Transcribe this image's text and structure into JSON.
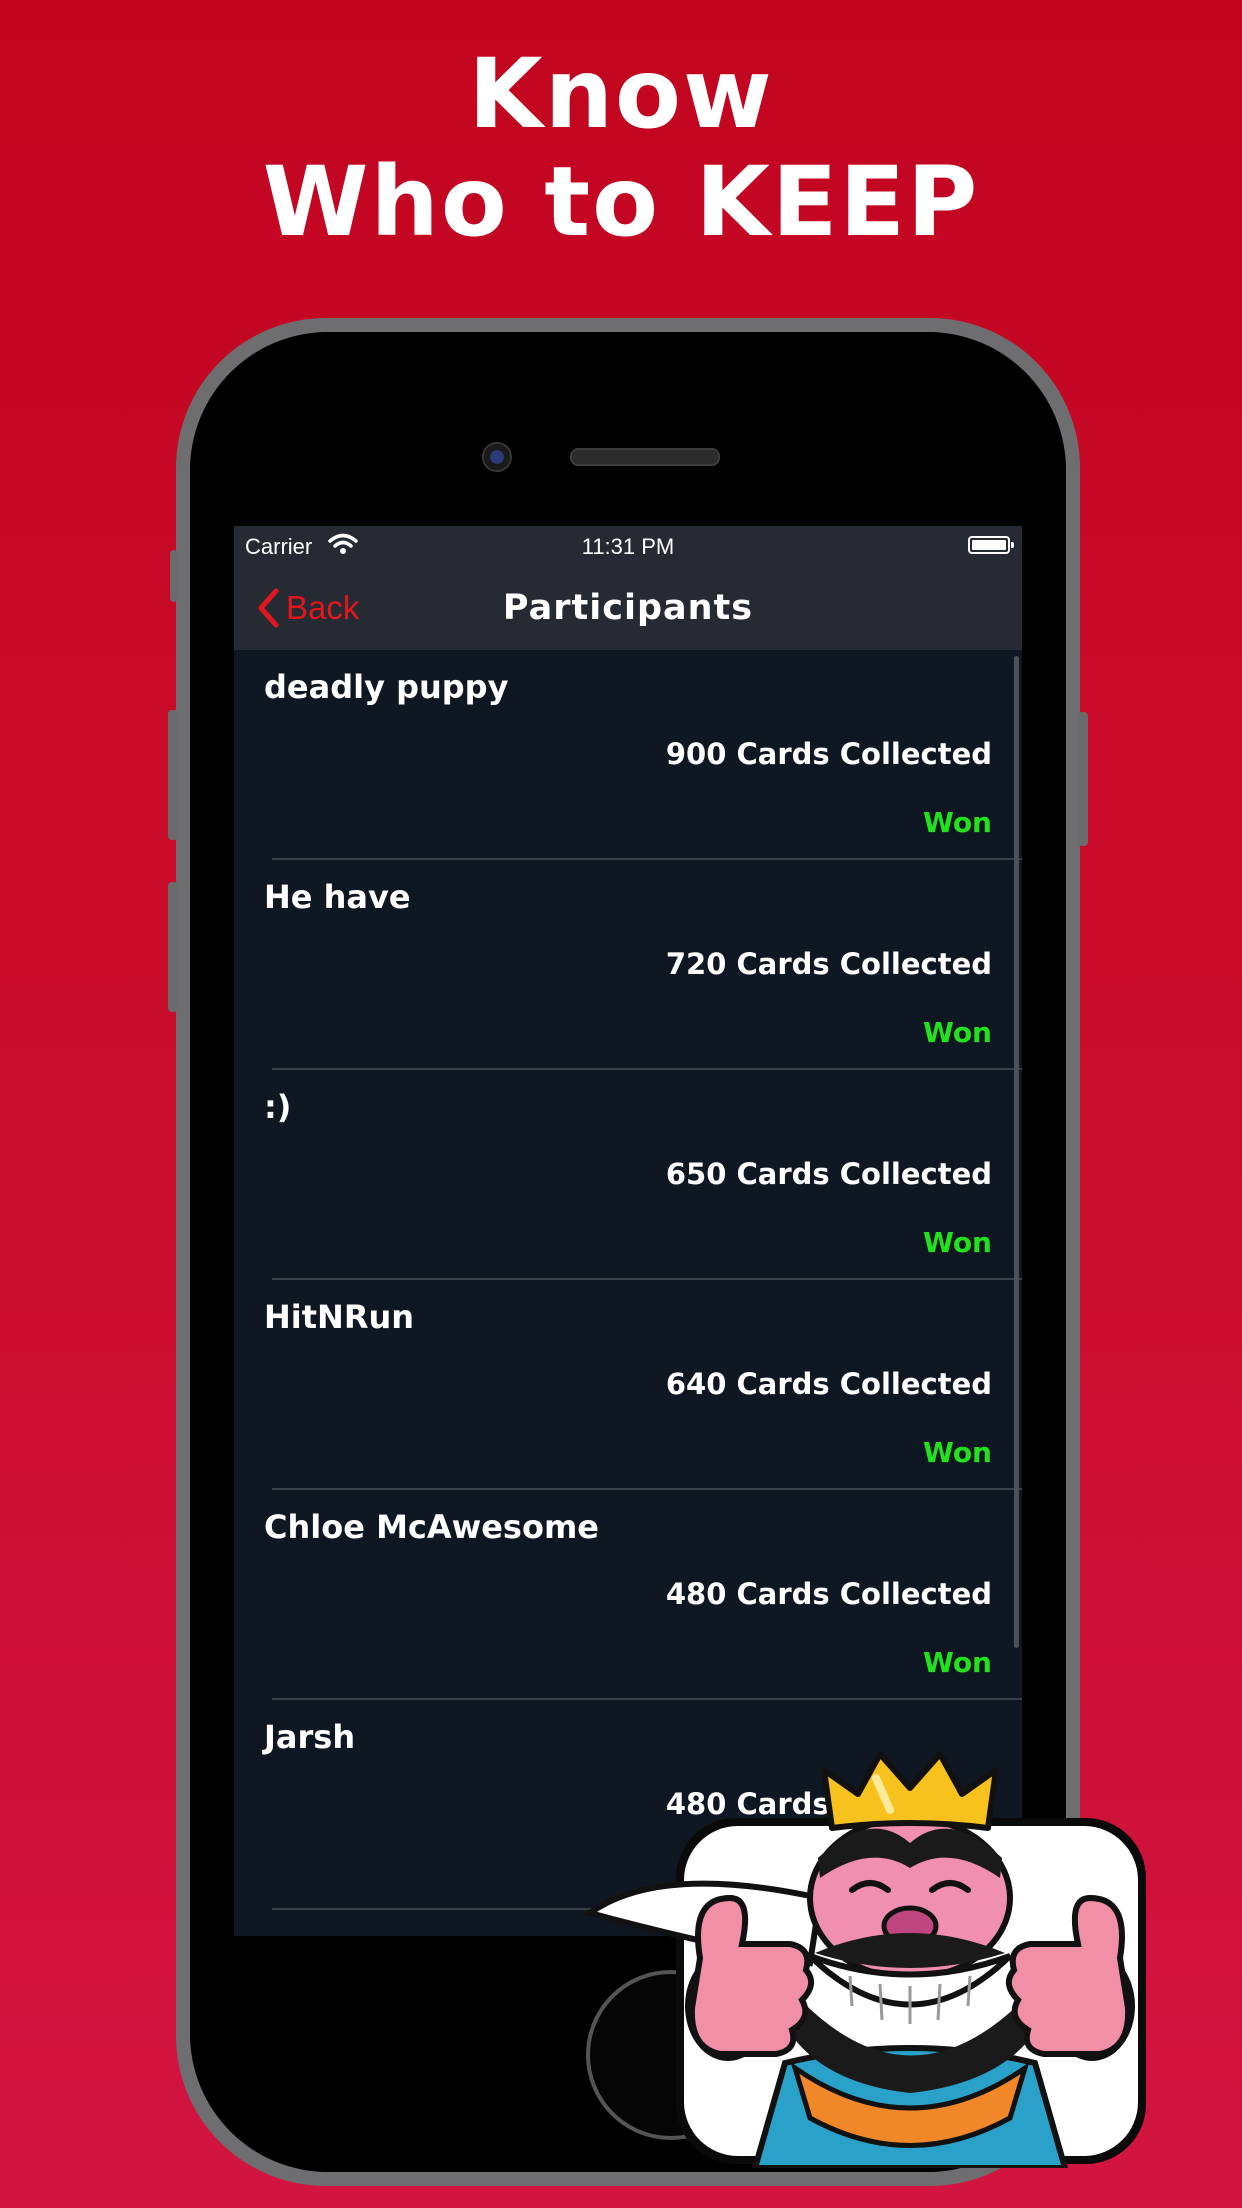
{
  "headline": {
    "line1": "Know",
    "line2": "Who to KEEP"
  },
  "status_bar": {
    "carrier": "Carrier",
    "time": "11:31 PM"
  },
  "nav": {
    "back_label": "Back",
    "title": "Participants"
  },
  "participants": [
    {
      "name": "deadly puppy",
      "cards": "900 Cards Collected",
      "result": "Won"
    },
    {
      "name": "He have",
      "cards": "720 Cards Collected",
      "result": "Won"
    },
    {
      "name": ":)",
      "cards": "650 Cards Collected",
      "result": "Won"
    },
    {
      "name": "HitNRun",
      "cards": "640 Cards Collected",
      "result": "Won"
    },
    {
      "name": "Chloe McAwesome",
      "cards": "480 Cards Collected",
      "result": "Won"
    },
    {
      "name": "Jarsh",
      "cards": "480 Cards Collected",
      "result": ""
    }
  ],
  "colors": {
    "background": "#c90d2c",
    "screen_bg": "#0f1822",
    "navbar_bg": "#262b33",
    "accent_red": "#e2161c",
    "won_green": "#22e11e"
  },
  "icons": [
    "wifi-icon",
    "battery-icon",
    "chevron-left-icon",
    "king-thumbs-up-emote"
  ]
}
